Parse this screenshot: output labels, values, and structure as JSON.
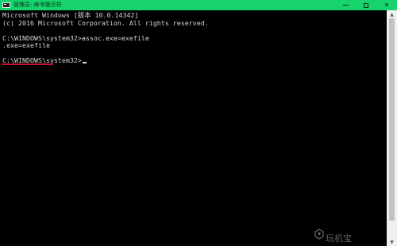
{
  "window": {
    "title": "管理员: 命令提示符",
    "buttons": {
      "minimize": "minimize",
      "maximize": "maximize",
      "close": "✕"
    }
  },
  "console": {
    "lines": [
      "Microsoft Windows [版本 10.0.14342]",
      "(c) 2016 Microsoft Corporation. All rights reserved.",
      "",
      "C:\\WINDOWS\\system32>assoc.exe=exefile",
      ".exe=exefile",
      "",
      "C:\\WINDOWS\\system32>"
    ],
    "text_color": "#d4d4d4",
    "background": "#000000",
    "highlight_color": "#c6162c"
  },
  "colors": {
    "titlebar": "#17d36b"
  },
  "icons": {
    "app": "cmd-icon",
    "scroll_up": "scroll-up-arrow-icon",
    "scroll_down": "scroll-down-arrow-icon"
  },
  "watermark": {
    "text": "玩机宝"
  }
}
